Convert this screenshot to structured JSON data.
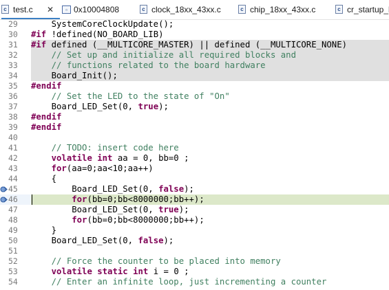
{
  "tabs": [
    {
      "label": "test.c",
      "icon": "c-file-icon",
      "active": true,
      "close": "✕"
    },
    {
      "label": "0x10004808",
      "icon": "memory-icon",
      "active": false
    },
    {
      "label": "clock_18xx_43xx.c",
      "icon": "c-file-icon",
      "active": false
    },
    {
      "label": "chip_18xx_43xx.c",
      "icon": "c-file-icon",
      "active": false
    },
    {
      "label": "cr_startup_lp",
      "icon": "c-file-icon",
      "active": false
    }
  ],
  "lines": [
    {
      "n": "29",
      "state": "normal",
      "tokens": [
        [
          "t",
          "    SystemCoreClockUpdate();"
        ]
      ]
    },
    {
      "n": "30",
      "state": "normal",
      "tokens": [
        [
          "p",
          "#if"
        ],
        [
          "t",
          " !defined(NO_BOARD_LIB)"
        ]
      ]
    },
    {
      "n": "31",
      "state": "inactive",
      "tokens": [
        [
          "p",
          "#if"
        ],
        [
          "t",
          " defined (__MULTICORE_MASTER) || defined (__MULTICORE_NONE)"
        ]
      ]
    },
    {
      "n": "32",
      "state": "inactive",
      "tokens": [
        [
          "c",
          "    // Set up and initialize all required blocks and"
        ]
      ]
    },
    {
      "n": "33",
      "state": "inactive",
      "tokens": [
        [
          "c",
          "    // functions related to the board hardware"
        ]
      ]
    },
    {
      "n": "34",
      "state": "inactive",
      "tokens": [
        [
          "t",
          "    Board_Init();"
        ]
      ]
    },
    {
      "n": "35",
      "state": "normal",
      "tokens": [
        [
          "p",
          "#endif"
        ]
      ]
    },
    {
      "n": "36",
      "state": "normal",
      "tokens": [
        [
          "c",
          "    // Set the LED to the state of \"On\""
        ]
      ]
    },
    {
      "n": "37",
      "state": "normal",
      "tokens": [
        [
          "t",
          "    Board_LED_Set(0, "
        ],
        [
          "k",
          "true"
        ],
        [
          "t",
          ");"
        ]
      ]
    },
    {
      "n": "38",
      "state": "normal",
      "tokens": [
        [
          "p",
          "#endif"
        ]
      ]
    },
    {
      "n": "39",
      "state": "normal",
      "tokens": [
        [
          "p",
          "#endif"
        ]
      ]
    },
    {
      "n": "40",
      "state": "normal",
      "tokens": [
        [
          "t",
          ""
        ]
      ]
    },
    {
      "n": "41",
      "state": "normal",
      "tokens": [
        [
          "c",
          "    // TODO: insert code here"
        ]
      ]
    },
    {
      "n": "42",
      "state": "normal",
      "tokens": [
        [
          "t",
          "    "
        ],
        [
          "k",
          "volatile int"
        ],
        [
          "t",
          " aa = 0, bb=0 ;"
        ]
      ]
    },
    {
      "n": "43",
      "state": "normal",
      "tokens": [
        [
          "t",
          "    "
        ],
        [
          "k",
          "for"
        ],
        [
          "t",
          "(aa=0;aa<10;aa++)"
        ]
      ]
    },
    {
      "n": "44",
      "state": "normal",
      "tokens": [
        [
          "t",
          "    {"
        ]
      ]
    },
    {
      "n": "45",
      "state": "normal",
      "marker": true,
      "tokens": [
        [
          "t",
          "        Board_LED_Set(0, "
        ],
        [
          "k",
          "false"
        ],
        [
          "t",
          ");"
        ]
      ]
    },
    {
      "n": "46",
      "state": "current",
      "marker": true,
      "tokens": [
        [
          "t",
          "        "
        ],
        [
          "k",
          "for"
        ],
        [
          "t",
          "(bb=0;bb<8000000;bb++);"
        ]
      ]
    },
    {
      "n": "47",
      "state": "normal",
      "tokens": [
        [
          "t",
          "        Board_LED_Set(0, "
        ],
        [
          "k",
          "true"
        ],
        [
          "t",
          ");"
        ]
      ]
    },
    {
      "n": "48",
      "state": "normal",
      "tokens": [
        [
          "t",
          "        "
        ],
        [
          "k",
          "for"
        ],
        [
          "t",
          "(bb=0;bb<8000000;bb++);"
        ]
      ]
    },
    {
      "n": "49",
      "state": "normal",
      "tokens": [
        [
          "t",
          "    }"
        ]
      ]
    },
    {
      "n": "50",
      "state": "normal",
      "tokens": [
        [
          "t",
          "    Board_LED_Set(0, "
        ],
        [
          "k",
          "false"
        ],
        [
          "t",
          ");"
        ]
      ]
    },
    {
      "n": "51",
      "state": "normal",
      "tokens": [
        [
          "t",
          ""
        ]
      ]
    },
    {
      "n": "52",
      "state": "normal",
      "tokens": [
        [
          "c",
          "    // Force the counter to be placed into memory"
        ]
      ]
    },
    {
      "n": "53",
      "state": "normal",
      "tokens": [
        [
          "t",
          "    "
        ],
        [
          "k",
          "volatile static int"
        ],
        [
          "t",
          " i = 0 ;"
        ]
      ]
    },
    {
      "n": "54",
      "state": "normal",
      "tokens": [
        [
          "c",
          "    // Enter an infinite loop, just incrementing a counter"
        ]
      ]
    }
  ],
  "colors": {
    "keyword": "#7f0055",
    "comment": "#3f7f5f",
    "inactive_bg": "#e0e0e0",
    "current_bg": "#dce8c9"
  }
}
